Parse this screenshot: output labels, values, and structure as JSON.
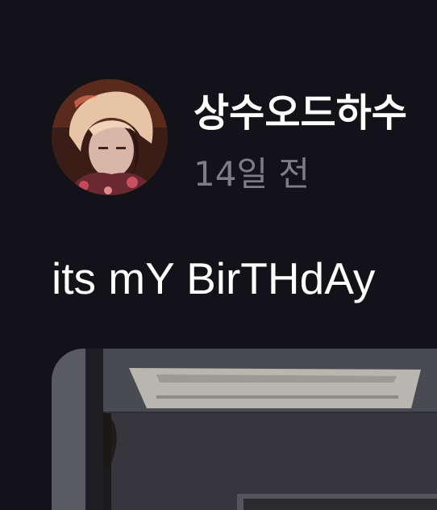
{
  "post": {
    "author": {
      "name": "상수오드하수",
      "avatar_icon": "profile-photo"
    },
    "time": "14일 전",
    "text": "its mY BirTHdAy",
    "image_icon": "attached-photo"
  },
  "colors": {
    "background": "#131218",
    "text_primary": "#ffffff",
    "text_secondary": "#7e7d84"
  }
}
